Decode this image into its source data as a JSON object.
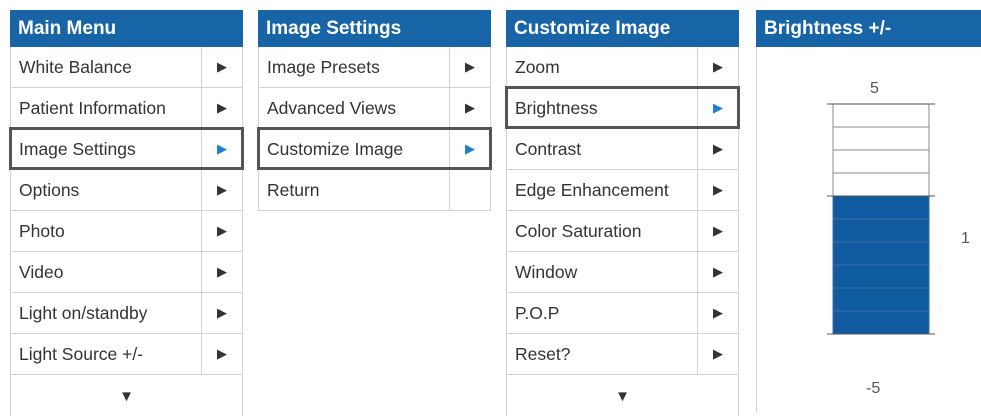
{
  "main_menu": {
    "title": "Main Menu",
    "items": [
      {
        "label": "White Balance",
        "arrow": "▶"
      },
      {
        "label": "Patient Information",
        "arrow": "▶"
      },
      {
        "label": "Image Settings",
        "arrow": "▶"
      },
      {
        "label": "Options",
        "arrow": "▶"
      },
      {
        "label": "Photo",
        "arrow": "▶"
      },
      {
        "label": "Video",
        "arrow": "▶"
      },
      {
        "label": "Light on/standby",
        "arrow": "▶"
      },
      {
        "label": "Light Source +/-",
        "arrow": "▶"
      }
    ],
    "more_arrow": "▼"
  },
  "image_settings": {
    "title": "Image Settings",
    "items": [
      {
        "label": "Image Presets",
        "arrow": "▶"
      },
      {
        "label": "Advanced Views",
        "arrow": "▶"
      },
      {
        "label": "Customize Image",
        "arrow": "▶"
      },
      {
        "label": "Return",
        "arrow": ""
      }
    ]
  },
  "customize_image": {
    "title": "Customize Image",
    "items": [
      {
        "label": "Zoom",
        "arrow": "▶"
      },
      {
        "label": "Brightness",
        "arrow": "▶"
      },
      {
        "label": "Contrast",
        "arrow": "▶"
      },
      {
        "label": "Edge Enhancement",
        "arrow": "▶"
      },
      {
        "label": "Color Saturation",
        "arrow": "▶"
      },
      {
        "label": "Window",
        "arrow": "▶"
      },
      {
        "label": "P.O.P",
        "arrow": "▶"
      },
      {
        "label": "Reset?",
        "arrow": "▶"
      }
    ],
    "more_arrow": "▼"
  },
  "brightness": {
    "title": "Brightness +/-",
    "max_label": "5",
    "min_label": "-5",
    "current_label": "1",
    "min": -5,
    "max": 5,
    "value": 1
  },
  "colors": {
    "header": "#1764a6",
    "selected_arrow": "#1e7fd1",
    "bar_fill": "#0f5aa0"
  }
}
